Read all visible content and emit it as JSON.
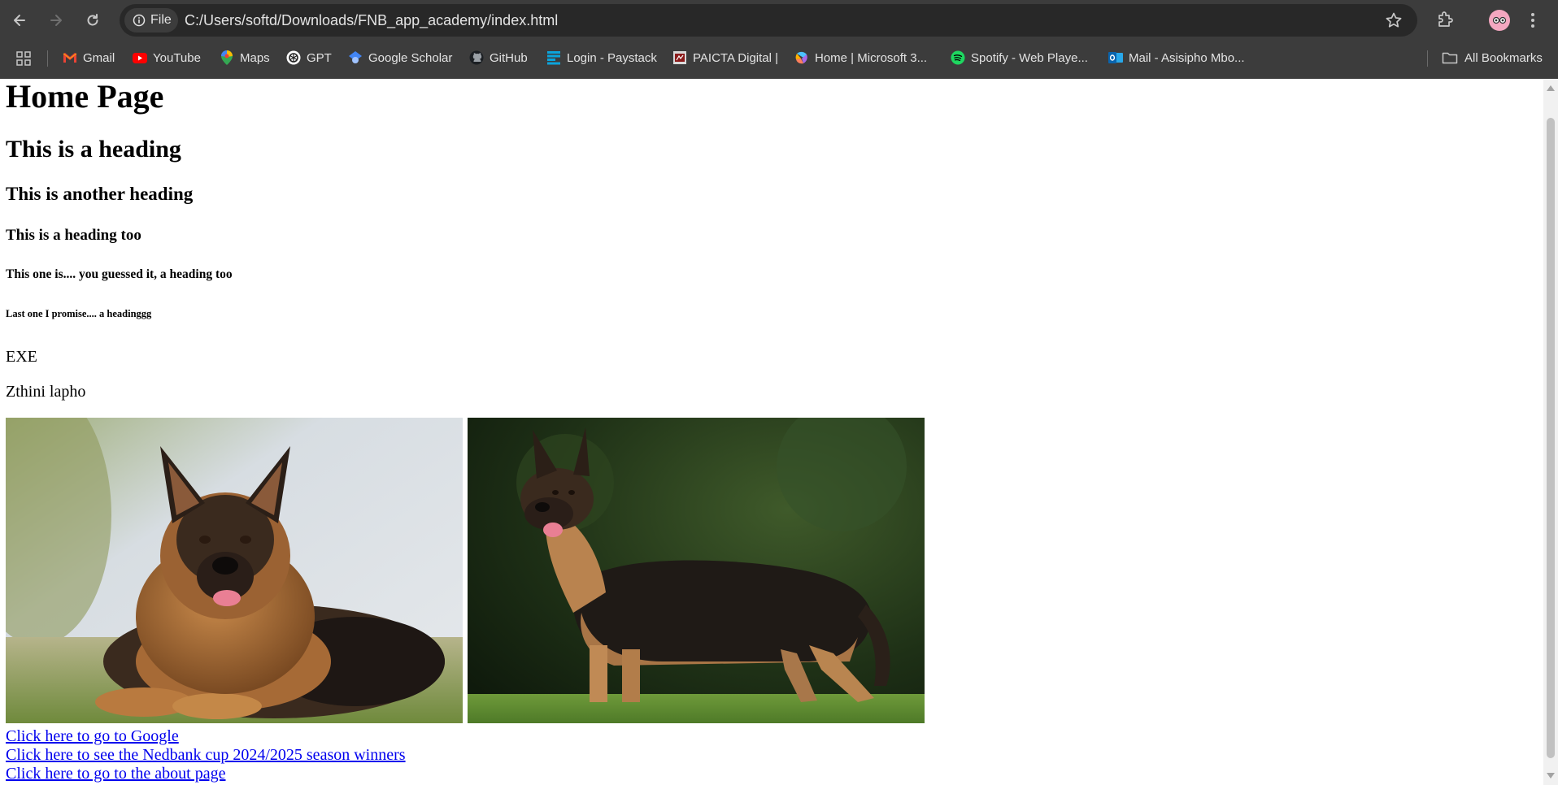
{
  "browser": {
    "site_chip_label": "File",
    "url": "C:/Users/softd/Downloads/FNB_app_academy/index.html",
    "bookmarks": [
      {
        "label": "Gmail",
        "icon": "gmail-icon"
      },
      {
        "label": "YouTube",
        "icon": "youtube-icon"
      },
      {
        "label": "Maps",
        "icon": "maps-icon"
      },
      {
        "label": "GPT",
        "icon": "openai-icon"
      },
      {
        "label": "Google Scholar",
        "icon": "scholar-icon"
      },
      {
        "label": "GitHub",
        "icon": "github-icon"
      },
      {
        "label": "Login - Paystack",
        "icon": "paystack-icon"
      },
      {
        "label": "PAICTA Digital |",
        "icon": "paicta-icon"
      },
      {
        "label": "Home | Microsoft 3...",
        "icon": "microsoft365-icon"
      },
      {
        "label": "Spotify - Web Playe...",
        "icon": "spotify-icon"
      },
      {
        "label": "Mail - Asisipho Mbo...",
        "icon": "outlook-icon"
      }
    ],
    "all_bookmarks_label": "All Bookmarks"
  },
  "page": {
    "h1": "Home Page",
    "h2": "This is a heading",
    "h3": "This is another heading",
    "h4": "This is a heading too",
    "h5": "This one is.... you guessed it, a heading too",
    "h6": "Last one I promise.... a headinggg",
    "p1": "EXE",
    "p2": "Zthini lapho",
    "images": [
      {
        "subject": "german-shepherd-lying"
      },
      {
        "subject": "german-shepherd-standing"
      }
    ],
    "links": [
      "Click here to go to Google",
      "Click here to see the Nedbank cup 2024/2025 season winners",
      "Click here to go to the about page"
    ]
  },
  "colors": {
    "chrome_bg": "#3c3c3c",
    "omnibox_bg": "#282828",
    "link": "#0000ee"
  }
}
